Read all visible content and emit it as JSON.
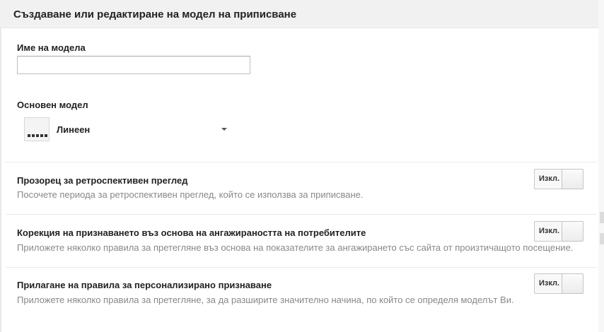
{
  "header": {
    "title": "Създаване или редактиране на модел на приписване"
  },
  "model_name": {
    "label": "Име на модела",
    "value": "",
    "placeholder": ""
  },
  "base_model": {
    "label": "Основен модел",
    "selected": "Линеен",
    "icon": "linear-model-icon"
  },
  "sections": [
    {
      "title": "Прозорец за ретроспективен преглед",
      "description": "Посочете периода за ретроспективен преглед, който се използва за приписване.",
      "toggle_label": "Изкл."
    },
    {
      "title": "Корекция на признаването въз основа на ангажираността на потребителите",
      "description": "Приложете няколко правила за претегляне въз основа на показателите за ангажирането със сайта от произтичащото посещение.",
      "toggle_label": "Изкл."
    },
    {
      "title": "Прилагане на правила за персонализирано признаване",
      "description": "Приложете няколко правила за претегляне, за да разширите значително начина, по който се определя моделът Ви.",
      "toggle_label": "Изкл."
    }
  ],
  "colors": {
    "header_bg": "#f1f1f1",
    "text": "#222222",
    "muted_text": "#888888",
    "divider": "#ebebeb"
  }
}
